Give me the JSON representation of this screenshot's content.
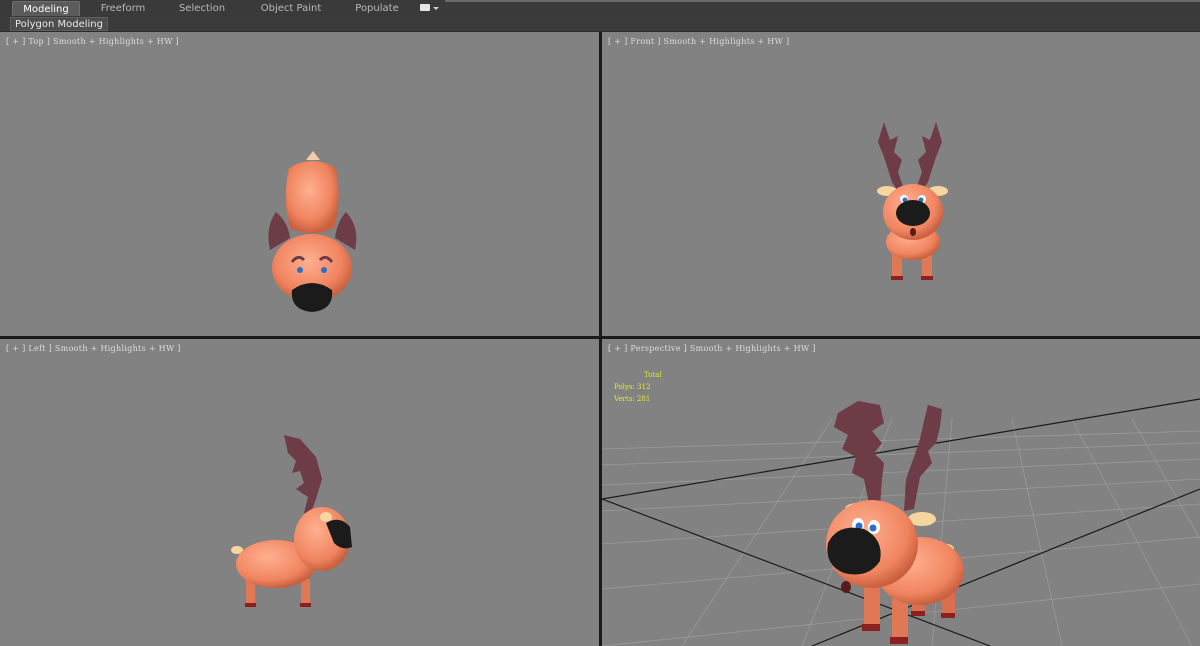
{
  "ribbon": {
    "tabs": [
      {
        "label": "Modeling",
        "active": true
      },
      {
        "label": "Freeform",
        "active": false
      },
      {
        "label": "Selection",
        "active": false
      },
      {
        "label": "Object Paint",
        "active": false
      },
      {
        "label": "Populate",
        "active": false
      }
    ],
    "toggle_icon": "ribbon-toggle-icon"
  },
  "subpanel": {
    "label": "Polygon Modeling"
  },
  "viewports": {
    "top": {
      "label": "[ + ] Top ] Smooth + Highlights + HW ]"
    },
    "front": {
      "label": "[ + ] Front ] Smooth + Highlights + HW ]"
    },
    "left": {
      "label": "[ + ] Left ] Smooth + Highlights + HW ]"
    },
    "perspective": {
      "label": "[ + ] Perspective ] Smooth + Highlights + HW ]",
      "stats": {
        "title": "Total",
        "polys_label": "Polys:",
        "polys_value": "312",
        "verts_label": "Verts:",
        "verts_value": "281"
      }
    }
  },
  "colors": {
    "viewport_bg": "#828282",
    "body": "#f08a6a",
    "antler": "#6e3c46",
    "nose": "#1b1b1b",
    "stats_text": "#e8e830"
  }
}
